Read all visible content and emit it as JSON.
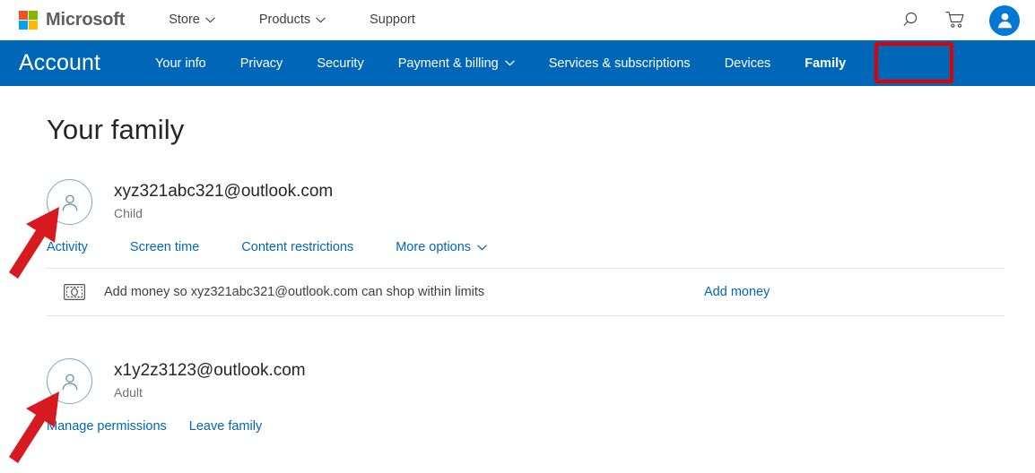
{
  "header": {
    "brand": "Microsoft",
    "nav": [
      {
        "label": "Store",
        "has_caret": true
      },
      {
        "label": "Products",
        "has_caret": true
      },
      {
        "label": "Support",
        "has_caret": false
      }
    ],
    "icons": {
      "search": "search-icon",
      "cart": "cart-icon",
      "account": "account-avatar-icon"
    }
  },
  "account_bar": {
    "title": "Account",
    "accent_color": "#0067b8",
    "highlight_color": "#e00000",
    "tabs": [
      {
        "label": "Your info",
        "active": false,
        "has_caret": false
      },
      {
        "label": "Privacy",
        "active": false,
        "has_caret": false
      },
      {
        "label": "Security",
        "active": false,
        "has_caret": false
      },
      {
        "label": "Payment & billing",
        "active": false,
        "has_caret": true
      },
      {
        "label": "Services & subscriptions",
        "active": false,
        "has_caret": false
      },
      {
        "label": "Devices",
        "active": false,
        "has_caret": false
      },
      {
        "label": "Family",
        "active": true,
        "has_caret": false
      }
    ],
    "highlighted_tab": "Family"
  },
  "page": {
    "title": "Your family",
    "link_color": "#0067b8"
  },
  "members": [
    {
      "email": "xyz321abc321@outlook.com",
      "role": "Child",
      "avatar_icon": "person-outline-icon",
      "links": [
        {
          "label": "Activity",
          "has_caret": false
        },
        {
          "label": "Screen time",
          "has_caret": false
        },
        {
          "label": "Content restrictions",
          "has_caret": false
        },
        {
          "label": "More options",
          "has_caret": true
        }
      ],
      "money_row": {
        "icon": "banknote-icon",
        "text": "Add money so xyz321abc321@outlook.com can shop within limits",
        "action_label": "Add money"
      }
    },
    {
      "email": "x1y2z3123@outlook.com",
      "role": "Adult",
      "avatar_icon": "person-outline-icon",
      "links": [
        {
          "label": "Manage permissions",
          "has_caret": false
        },
        {
          "label": "Leave family",
          "has_caret": false
        }
      ],
      "money_row": null
    }
  ],
  "annotations": {
    "arrows": [
      {
        "name": "red-arrow-child-avatar",
        "color": "#d71920"
      },
      {
        "name": "red-arrow-adult-avatar",
        "color": "#d71920"
      }
    ],
    "box": {
      "name": "red-box-family-tab",
      "color": "#e00000"
    }
  }
}
